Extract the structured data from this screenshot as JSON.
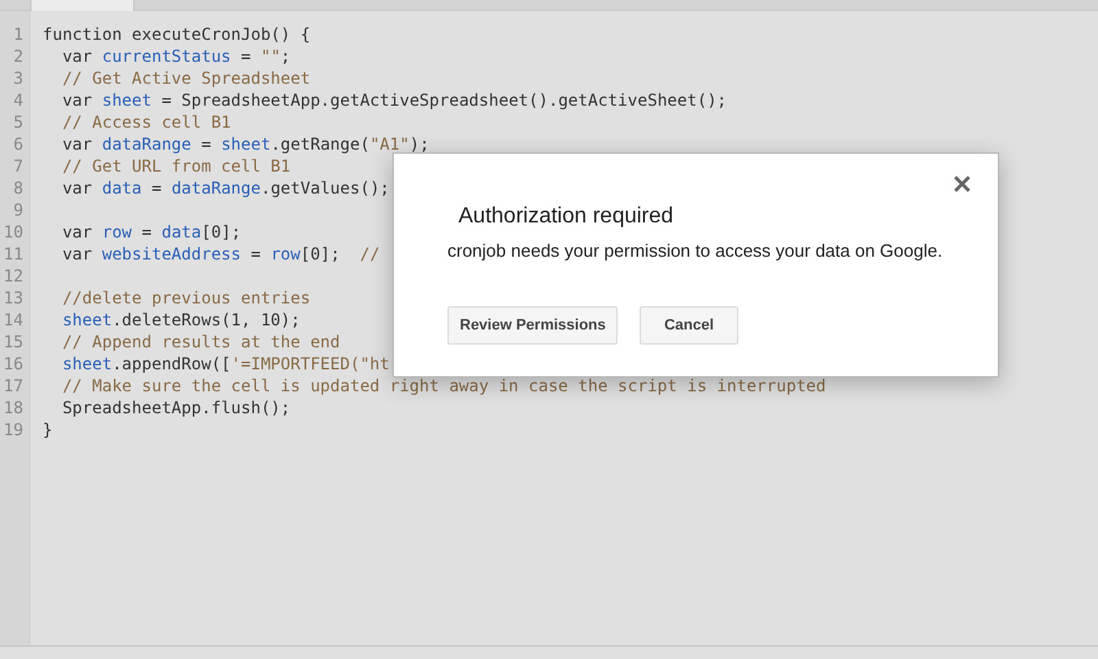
{
  "editor": {
    "lines": [
      {
        "number": "1",
        "segments": [
          {
            "kind": "plain",
            "text": "function executeCronJob() {"
          }
        ]
      },
      {
        "number": "2",
        "segments": [
          {
            "kind": "plain",
            "text": "  var "
          },
          {
            "kind": "def",
            "text": "currentStatus"
          },
          {
            "kind": "plain",
            "text": " = "
          },
          {
            "kind": "string",
            "text": "\"\""
          },
          {
            "kind": "plain",
            "text": ";"
          }
        ]
      },
      {
        "number": "3",
        "segments": [
          {
            "kind": "comment",
            "text": "  // Get Active Spreadsheet"
          }
        ]
      },
      {
        "number": "4",
        "segments": [
          {
            "kind": "plain",
            "text": "  var "
          },
          {
            "kind": "def",
            "text": "sheet"
          },
          {
            "kind": "plain",
            "text": " = SpreadsheetApp.getActiveSpreadsheet().getActiveSheet();"
          }
        ]
      },
      {
        "number": "5",
        "segments": [
          {
            "kind": "comment",
            "text": "  // Access cell B1"
          }
        ]
      },
      {
        "number": "6",
        "segments": [
          {
            "kind": "plain",
            "text": "  var "
          },
          {
            "kind": "def",
            "text": "dataRange"
          },
          {
            "kind": "plain",
            "text": " = "
          },
          {
            "kind": "def",
            "text": "sheet"
          },
          {
            "kind": "plain",
            "text": ".getRange("
          },
          {
            "kind": "string",
            "text": "\"A1\""
          },
          {
            "kind": "plain",
            "text": ");"
          }
        ]
      },
      {
        "number": "7",
        "segments": [
          {
            "kind": "comment",
            "text": "  // Get URL from cell B1"
          }
        ]
      },
      {
        "number": "8",
        "segments": [
          {
            "kind": "plain",
            "text": "  var "
          },
          {
            "kind": "def",
            "text": "data"
          },
          {
            "kind": "plain",
            "text": " = "
          },
          {
            "kind": "def",
            "text": "dataRange"
          },
          {
            "kind": "plain",
            "text": ".getValues();"
          }
        ]
      },
      {
        "number": "9"
      },
      {
        "number": "10",
        "segments": [
          {
            "kind": "plain",
            "text": "  var "
          },
          {
            "kind": "def",
            "text": "row"
          },
          {
            "kind": "plain",
            "text": " = "
          },
          {
            "kind": "def",
            "text": "data"
          },
          {
            "kind": "plain",
            "text": "[0];"
          }
        ]
      },
      {
        "number": "11",
        "segments": [
          {
            "kind": "plain",
            "text": "  var "
          },
          {
            "kind": "def",
            "text": "websiteAddress"
          },
          {
            "kind": "plain",
            "text": " = "
          },
          {
            "kind": "def",
            "text": "row"
          },
          {
            "kind": "plain",
            "text": "[0];  "
          },
          {
            "kind": "comment",
            "text": "//"
          }
        ]
      },
      {
        "number": "12"
      },
      {
        "number": "13",
        "segments": [
          {
            "kind": "comment",
            "text": "  //delete previous entries"
          }
        ]
      },
      {
        "number": "14",
        "segments": [
          {
            "kind": "def",
            "text": "  sheet"
          },
          {
            "kind": "plain",
            "text": ".deleteRows(1, 10);"
          }
        ]
      },
      {
        "number": "15",
        "segments": [
          {
            "kind": "comment",
            "text": "  // Append results at the end"
          }
        ]
      },
      {
        "number": "16",
        "segments": [
          {
            "kind": "def",
            "text": "  sheet"
          },
          {
            "kind": "plain",
            "text": ".appendRow(["
          },
          {
            "kind": "string",
            "text": "'=IMPORTFEED(\"ht"
          }
        ]
      },
      {
        "number": "17",
        "segments": [
          {
            "kind": "comment",
            "text": "  // Make sure the cell is updated right away in case the script is interrupted"
          }
        ]
      },
      {
        "number": "18",
        "segments": [
          {
            "kind": "plain",
            "text": "  SpreadsheetApp.flush();"
          }
        ]
      },
      {
        "number": "19",
        "segments": [
          {
            "kind": "plain",
            "text": "}"
          }
        ]
      }
    ]
  },
  "dialog": {
    "title": "Authorization required",
    "message": "cronjob needs your permission to access your data on Google.",
    "buttons": [
      "Review Permissions",
      "Cancel"
    ]
  }
}
